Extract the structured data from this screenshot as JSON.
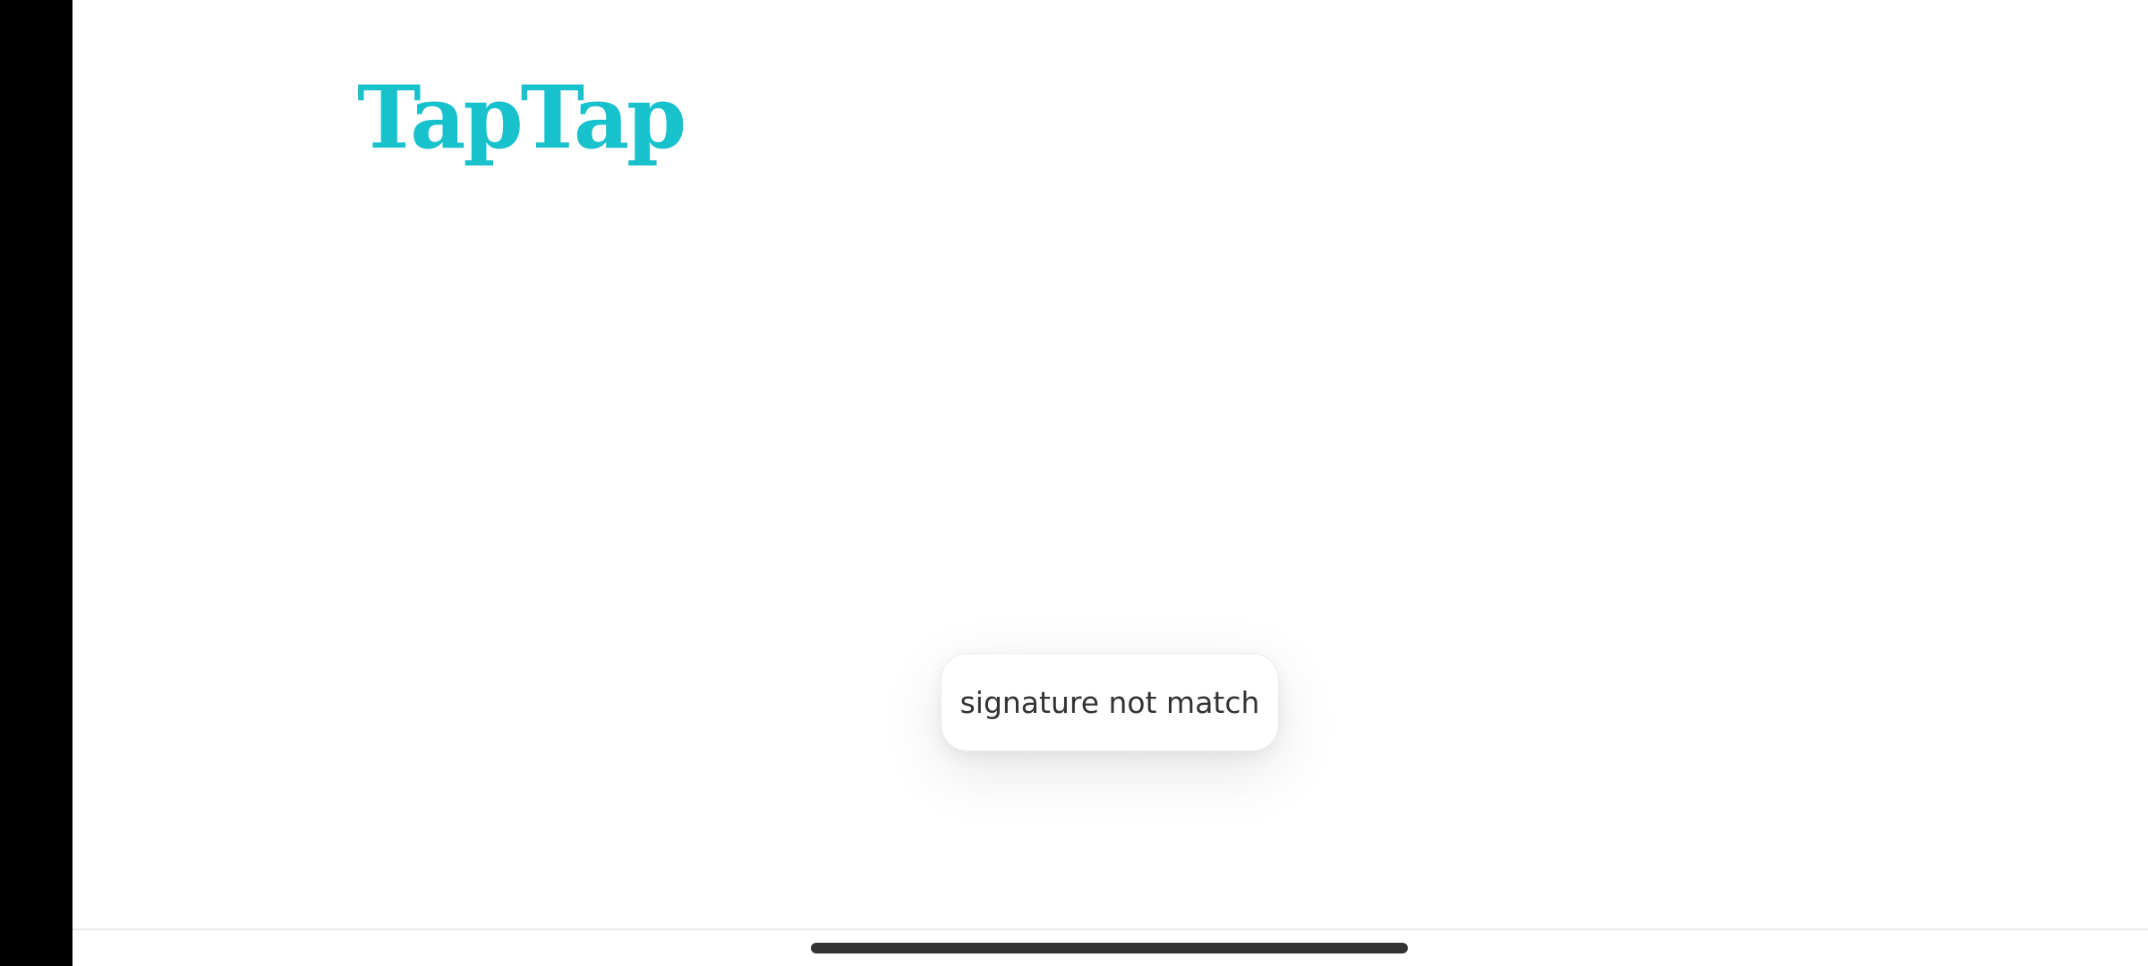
{
  "app": {
    "logo_text": "TapTap",
    "brand_color": "#18c2cc"
  },
  "toast": {
    "message": "signature not match"
  },
  "system": {
    "home_indicator_color": "#333333"
  }
}
